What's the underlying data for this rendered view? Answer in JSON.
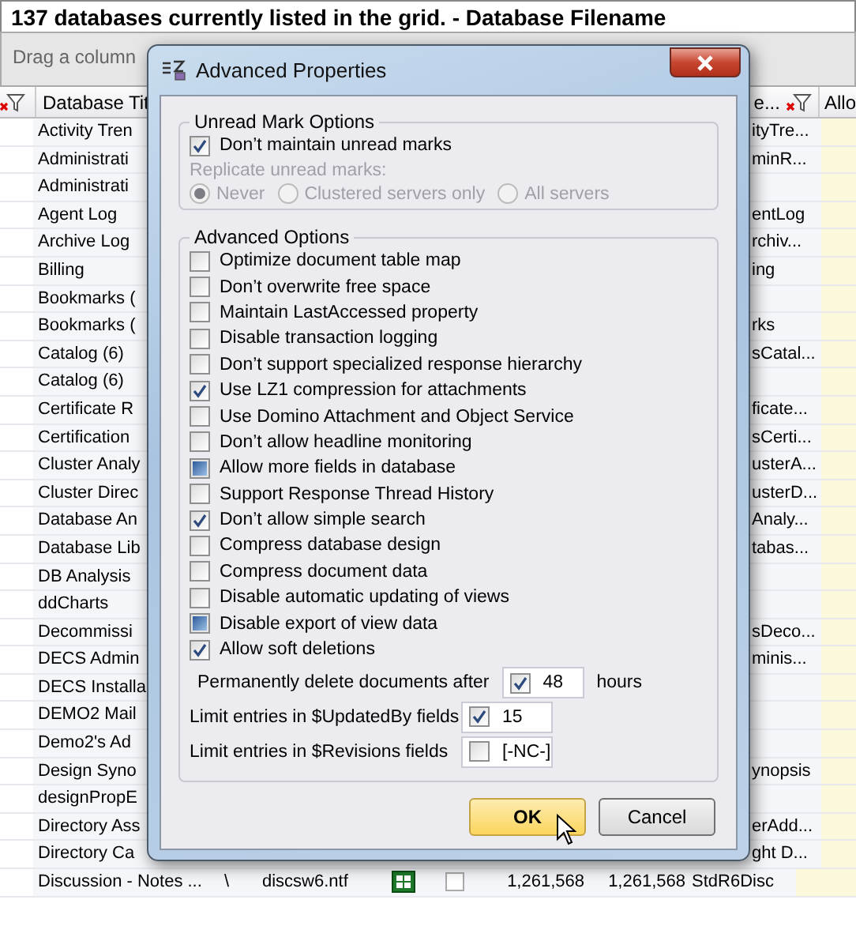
{
  "title_bar": {
    "text": "137 databases currently listed in the grid. - Database Filename"
  },
  "group_panel": {
    "hint": "Drag a column"
  },
  "grid": {
    "row_indicator_filter": true,
    "columns": [
      {
        "label": "Database Tit",
        "filter": false
      },
      {
        "label": "e...",
        "filter": true
      },
      {
        "label": "Allo",
        "filter": false
      }
    ],
    "rows": [
      {
        "kind": "cut",
        "column_1": "Activity Tren",
        "column_9": "ityTre..."
      },
      {
        "kind": "cut",
        "column_1": "Administrati",
        "column_9": "minR..."
      },
      {
        "kind": "cut",
        "column_1": "Administrati"
      },
      {
        "kind": "cut",
        "column_1": "Agent Log",
        "column_9": "entLog"
      },
      {
        "kind": "cut",
        "column_1": "Archive Log",
        "column_9": "rchiv..."
      },
      {
        "kind": "cut",
        "column_1": "Billing",
        "column_9": "ing"
      },
      {
        "kind": "cut",
        "column_1": "Bookmarks ("
      },
      {
        "kind": "cut",
        "column_1": "Bookmarks (",
        "column_9": "rks"
      },
      {
        "kind": "cut",
        "column_1": "Catalog (6)",
        "column_9": "sCatal..."
      },
      {
        "kind": "cut",
        "column_1": "Catalog (6)"
      },
      {
        "kind": "cut",
        "column_1": "Certificate R",
        "column_9": "ficate..."
      },
      {
        "kind": "cut",
        "column_1": "Certification",
        "column_9": "sCerti..."
      },
      {
        "kind": "cut",
        "column_1": "Cluster Analy",
        "column_9": "usterA..."
      },
      {
        "kind": "cut",
        "column_1": "Cluster Direc",
        "column_9": "usterD..."
      },
      {
        "kind": "cut",
        "column_1": "Database An",
        "column_9": "Analy..."
      },
      {
        "kind": "cut",
        "column_1": "Database Lib",
        "column_9": "tabas..."
      },
      {
        "kind": "cut",
        "column_1": "DB Analysis"
      },
      {
        "kind": "cut",
        "column_1": "ddCharts"
      },
      {
        "kind": "cut",
        "column_1": "Decommissi",
        "column_9": "sDeco..."
      },
      {
        "kind": "cut",
        "column_1": "DECS Admin",
        "column_9": "minis..."
      },
      {
        "kind": "cut",
        "column_1": "DECS Installa"
      },
      {
        "kind": "cut",
        "column_1": "DEMO2 Mail"
      },
      {
        "kind": "cut",
        "column_1": "Demo2's Ad"
      },
      {
        "kind": "cut",
        "column_1": "Design Syno",
        "column_9": "ynopsis"
      },
      {
        "kind": "cut",
        "column_1": "designPropE"
      },
      {
        "kind": "cut",
        "column_1": "Directory Ass",
        "column_9": "erAdd..."
      },
      {
        "kind": "cut",
        "column_1": "Directory Ca",
        "column_9": "ght D..."
      },
      {
        "kind": "full",
        "column_1": "Discussion - Notes ...",
        "column_2": "\\",
        "column_3": "discsw6.ntf",
        "checked": false,
        "column_6": "1,261,568",
        "column_7": "1,261,568",
        "column_8": "StdR6Disc"
      }
    ]
  },
  "dialog": {
    "title": "Advanced Properties",
    "unread_group": {
      "legend": "Unread Mark Options",
      "option": {
        "label": "Don’t maintain unread marks",
        "checked": true
      },
      "replicate_label": "Replicate unread marks:",
      "disabled": true,
      "radios": [
        {
          "label": "Never",
          "selected": true
        },
        {
          "label": "Clustered servers only",
          "selected": false
        },
        {
          "label": "All servers",
          "selected": false
        }
      ]
    },
    "advanced_group": {
      "legend": "Advanced Options",
      "options": [
        {
          "label": "Optimize document table map",
          "checked": false,
          "indeterminate": false
        },
        {
          "label": "Don’t overwrite free space",
          "checked": false,
          "indeterminate": false
        },
        {
          "label": "Maintain LastAccessed property",
          "checked": false,
          "indeterminate": false
        },
        {
          "label": "Disable transaction logging",
          "checked": false,
          "indeterminate": false
        },
        {
          "label": "Don’t support specialized response hierarchy",
          "checked": false,
          "indeterminate": false
        },
        {
          "label": "Use LZ1 compression for attachments",
          "checked": true,
          "indeterminate": false
        },
        {
          "label": "Use Domino Attachment and Object Service",
          "checked": false,
          "indeterminate": false
        },
        {
          "label": "Don’t allow headline monitoring",
          "checked": false,
          "indeterminate": false
        },
        {
          "label": "Allow more fields in database",
          "checked": false,
          "indeterminate": true
        },
        {
          "label": "Support Response Thread History",
          "checked": false,
          "indeterminate": false
        },
        {
          "label": "Don’t allow simple search",
          "checked": true,
          "indeterminate": false
        },
        {
          "label": "Compress database design",
          "checked": false,
          "indeterminate": false
        },
        {
          "label": "Compress document data",
          "checked": false,
          "indeterminate": false
        },
        {
          "label": "Disable automatic updating of views",
          "checked": false,
          "indeterminate": false
        },
        {
          "label": "Disable export of view data",
          "checked": false,
          "indeterminate": true
        },
        {
          "label": "Allow soft deletions",
          "checked": true,
          "indeterminate": false
        }
      ],
      "soft_delete": {
        "label": "Permanently delete documents after",
        "checked": true,
        "value": "48",
        "unit": "hours"
      },
      "limits": [
        {
          "label": "Limit entries in $UpdatedBy fields",
          "checked": true,
          "value": "15"
        },
        {
          "label": "Limit entries in $Revisions fields",
          "checked": false,
          "value": "[-NC-]"
        }
      ]
    },
    "buttons": [
      {
        "label": "OK",
        "kind": "default"
      },
      {
        "label": "Cancel",
        "kind": "normal"
      }
    ]
  }
}
